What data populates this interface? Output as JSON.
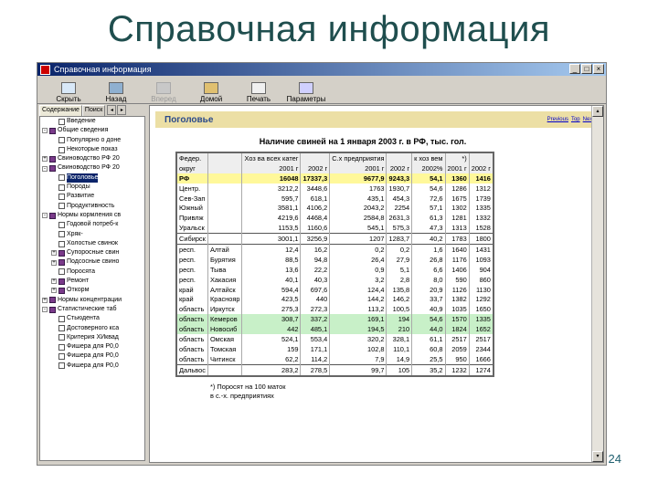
{
  "slide": {
    "title": "Справочная информация",
    "number": "24"
  },
  "window": {
    "title": "Справочная информация",
    "controls": [
      "_",
      "□",
      "×"
    ]
  },
  "toolbar": [
    {
      "label": "Скрыть",
      "icon": "hide-icon",
      "enabled": true
    },
    {
      "label": "Назад",
      "icon": "back-icon",
      "enabled": true
    },
    {
      "label": "Вперед",
      "icon": "forward-icon",
      "enabled": false
    },
    {
      "label": "Домой",
      "icon": "home-icon",
      "enabled": true
    },
    {
      "label": "Печать",
      "icon": "print-icon",
      "enabled": true
    },
    {
      "label": "Параметры",
      "icon": "options-icon",
      "enabled": true
    }
  ],
  "tabs": {
    "contents": "Содержание",
    "search": "Поиск"
  },
  "tree": [
    {
      "label": "Введение",
      "icon": "page",
      "level": 1,
      "exp": ""
    },
    {
      "label": "Общие сведения",
      "icon": "book",
      "level": 0,
      "exp": "-"
    },
    {
      "label": "Популярно о доне",
      "icon": "page",
      "level": 1,
      "exp": ""
    },
    {
      "label": "Некоторые показ",
      "icon": "page",
      "level": 1,
      "exp": ""
    },
    {
      "label": "Свиноводство РФ 20",
      "icon": "book",
      "level": 0,
      "exp": "+"
    },
    {
      "label": "Свиноводство РФ 20",
      "icon": "book",
      "level": 0,
      "exp": "-"
    },
    {
      "label": "Поголовье",
      "icon": "page",
      "level": 1,
      "exp": "",
      "selected": true
    },
    {
      "label": "Породы",
      "icon": "page",
      "level": 1,
      "exp": ""
    },
    {
      "label": "Развитие",
      "icon": "page",
      "level": 1,
      "exp": ""
    },
    {
      "label": "Продуктивность",
      "icon": "page",
      "level": 1,
      "exp": ""
    },
    {
      "label": "Нормы кормления св",
      "icon": "book",
      "level": 0,
      "exp": "-"
    },
    {
      "label": "Годовой потреб-к",
      "icon": "page",
      "level": 1,
      "exp": ""
    },
    {
      "label": "Хряк-",
      "icon": "page",
      "level": 1,
      "exp": ""
    },
    {
      "label": "Холостые свинок",
      "icon": "page",
      "level": 1,
      "exp": ""
    },
    {
      "label": "Супоросные свин",
      "icon": "book",
      "level": 1,
      "exp": "+"
    },
    {
      "label": "Подсосные свино",
      "icon": "book",
      "level": 1,
      "exp": "+"
    },
    {
      "label": "Поросята",
      "icon": "page",
      "level": 1,
      "exp": ""
    },
    {
      "label": "Ремонт",
      "icon": "book",
      "level": 1,
      "exp": "+"
    },
    {
      "label": "Откорм",
      "icon": "book",
      "level": 1,
      "exp": "+"
    },
    {
      "label": "Нормы концентрации",
      "icon": "book",
      "level": 0,
      "exp": "+"
    },
    {
      "label": "Статистические таб",
      "icon": "book",
      "level": 0,
      "exp": "-"
    },
    {
      "label": "Стьюдента",
      "icon": "page",
      "level": 1,
      "exp": ""
    },
    {
      "label": "Достоверного кса",
      "icon": "page",
      "level": 1,
      "exp": ""
    },
    {
      "label": "Критерия ХИквад",
      "icon": "page",
      "level": 1,
      "exp": ""
    },
    {
      "label": "Фишера для Р0,0",
      "icon": "page",
      "level": 1,
      "exp": ""
    },
    {
      "label": "Фишера для Р0,0",
      "icon": "page",
      "level": 1,
      "exp": ""
    },
    {
      "label": "Фишера для Р0,0",
      "icon": "page",
      "level": 1,
      "exp": ""
    }
  ],
  "content": {
    "header_title": "Поголовье",
    "nav_links": [
      "Previous",
      "Top",
      "Next"
    ],
    "caption": "Наличие свиней на 1 января 2003 г. в РФ, тыс. гол.",
    "footnote_lines": [
      "*) Поросят на 100 маток",
      "в с.-х. предприятиях"
    ],
    "header_rows": [
      [
        "Федер.",
        "",
        "Хоз ва всех катег",
        "",
        "С.х предприятия",
        "",
        "к хоз вем",
        "*)",
        ""
      ],
      [
        "округ",
        "",
        "2001 г",
        "2002 г",
        "2001 г",
        "2002 г",
        "2002%",
        "2001 г",
        "2002 г"
      ]
    ],
    "rows": [
      {
        "cells": [
          "РФ",
          "",
          "16048",
          "17337,3",
          "9677,9",
          "9243,3",
          "54,1",
          "1360",
          "1416"
        ],
        "style": "hl-yellow"
      },
      {
        "cells": [
          "Центр.",
          "",
          "3212,2",
          "3448,6",
          "1763",
          "1930,7",
          "54,6",
          "1286",
          "1312"
        ],
        "style": ""
      },
      {
        "cells": [
          "Сев-Зап",
          "",
          "595,7",
          "618,1",
          "435,1",
          "454,3",
          "72,6",
          "1675",
          "1739"
        ],
        "style": ""
      },
      {
        "cells": [
          "Южный",
          "",
          "3581,1",
          "4106,2",
          "2043,2",
          "2254",
          "57,1",
          "1302",
          "1335"
        ],
        "style": ""
      },
      {
        "cells": [
          "Привлж",
          "",
          "4219,6",
          "4468,4",
          "2584,8",
          "2631,3",
          "61,3",
          "1281",
          "1332"
        ],
        "style": ""
      },
      {
        "cells": [
          "Уральск",
          "",
          "1153,5",
          "1160,6",
          "545,1",
          "575,3",
          "47,3",
          "1313",
          "1528"
        ],
        "style": ""
      },
      {
        "cells": [
          "Сибирск",
          "",
          "3001,1",
          "3256,9",
          "1207",
          "1283,7",
          "40,2",
          "1783",
          "1800"
        ],
        "style": "sep-top"
      },
      {
        "cells": [
          "респ.",
          "Алтай",
          "12,4",
          "16,2",
          "0,2",
          "0,2",
          "1,6",
          "1640",
          "1431"
        ],
        "style": "sep-top"
      },
      {
        "cells": [
          "респ.",
          "Бурятия",
          "88,5",
          "94,8",
          "26,4",
          "27,9",
          "26,8",
          "1176",
          "1093"
        ],
        "style": ""
      },
      {
        "cells": [
          "респ.",
          "Тыва",
          "13,6",
          "22,2",
          "0,9",
          "5,1",
          "6,6",
          "1406",
          "904"
        ],
        "style": ""
      },
      {
        "cells": [
          "респ.",
          "Хакасия",
          "40,1",
          "40,3",
          "3,2",
          "2,8",
          "8,0",
          "590",
          "860"
        ],
        "style": ""
      },
      {
        "cells": [
          "край",
          "Алтайск",
          "594,4",
          "697,6",
          "124,4",
          "135,8",
          "20,9",
          "1126",
          "1130"
        ],
        "style": ""
      },
      {
        "cells": [
          "край",
          "Краснояр",
          "423,5",
          "440",
          "144,2",
          "146,2",
          "33,7",
          "1382",
          "1292"
        ],
        "style": ""
      },
      {
        "cells": [
          "область",
          "Иркутск",
          "275,3",
          "272,3",
          "113,2",
          "100,5",
          "40,9",
          "1035",
          "1650"
        ],
        "style": ""
      },
      {
        "cells": [
          "область",
          "Кемеров",
          "308,7",
          "337,2",
          "169,1",
          "194",
          "54,6",
          "1570",
          "1335"
        ],
        "style": "hl-green"
      },
      {
        "cells": [
          "область",
          "Новосиб",
          "442",
          "485,1",
          "194,5",
          "210",
          "44,0",
          "1824",
          "1652"
        ],
        "style": "hl-green"
      },
      {
        "cells": [
          "область",
          "Омская",
          "524,1",
          "553,4",
          "320,2",
          "328,1",
          "61,1",
          "2517",
          "2517"
        ],
        "style": ""
      },
      {
        "cells": [
          "область",
          "Томская",
          "159",
          "171,1",
          "102,8",
          "110,1",
          "60,8",
          "2059",
          "2344"
        ],
        "style": ""
      },
      {
        "cells": [
          "область",
          "Читинск",
          "62,2",
          "114,2",
          "7,9",
          "14,9",
          "25,5",
          "950",
          "1666"
        ],
        "style": ""
      },
      {
        "cells": [
          "Дальвос",
          "",
          "283,2",
          "278,5",
          "99,7",
          "105",
          "35,2",
          "1232",
          "1274"
        ],
        "style": "sep-top"
      }
    ]
  }
}
